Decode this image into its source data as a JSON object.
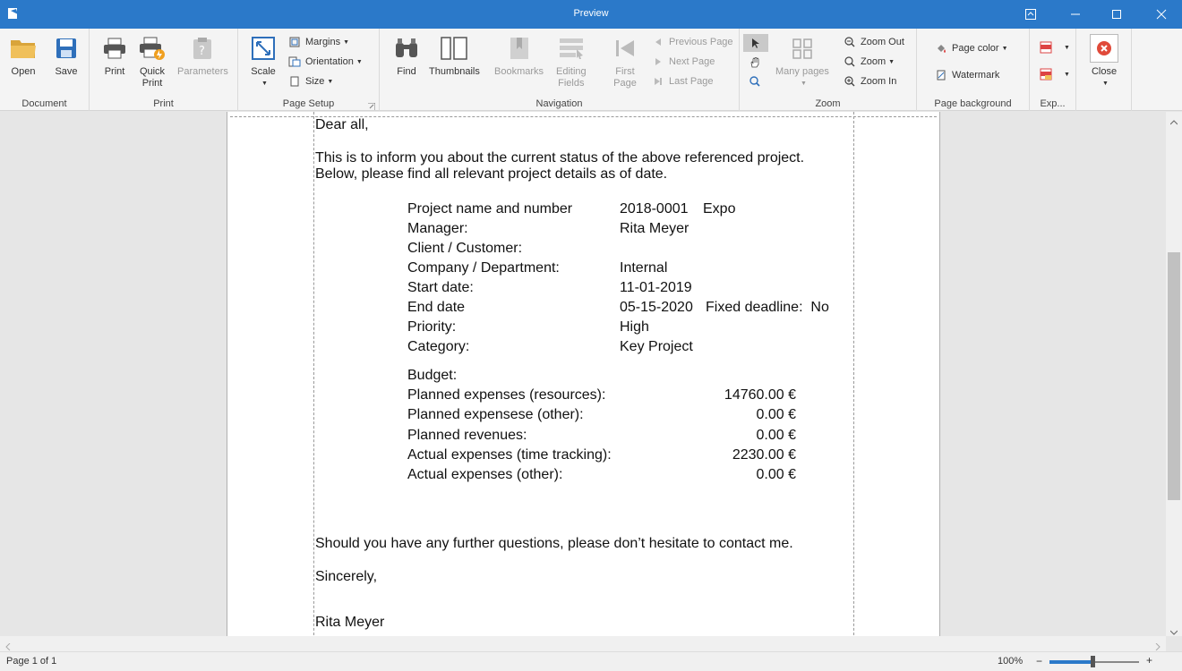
{
  "window": {
    "title": "Preview"
  },
  "ribbon": {
    "groups": {
      "document": "Document",
      "print": "Print",
      "page_setup": "Page Setup",
      "navigation": "Navigation",
      "zoom": "Zoom",
      "page_background": "Page background",
      "export": "Exp..."
    },
    "buttons": {
      "open": "Open",
      "save": "Save",
      "print": "Print",
      "quick_print_1": "Quick",
      "quick_print_2": "Print",
      "parameters": "Parameters",
      "scale": "Scale",
      "margins": "Margins",
      "orientation": "Orientation",
      "size": "Size",
      "find": "Find",
      "thumbnails": "Thumbnails",
      "bookmarks": "Bookmarks",
      "editing_fields_1": "Editing",
      "editing_fields_2": "Fields",
      "first_page_1": "First",
      "first_page_2": "Page",
      "previous_page": "Previous Page",
      "next_page": "Next Page",
      "last_page": "Last Page",
      "many_pages": "Many pages",
      "zoom_out": "Zoom Out",
      "zoom": "Zoom",
      "zoom_in": "Zoom In",
      "page_color": "Page color",
      "watermark": "Watermark",
      "close": "Close"
    }
  },
  "document": {
    "greeting": "Dear all,",
    "intro_1": "This is to inform you about the current status of the above referenced project.",
    "intro_2": "Below, please find all relevant project details as of date.",
    "details": [
      {
        "label": "Project name and number",
        "value": "2018-0001",
        "extra": "Expo"
      },
      {
        "label": "Manager:",
        "value": "Rita Meyer"
      },
      {
        "label": "Client / Customer:",
        "value": ""
      },
      {
        "label": "Company / Department:",
        "value": "Internal"
      },
      {
        "label": "Start date:",
        "value": "11-01-2019"
      },
      {
        "label": "End date",
        "value": "05-15-2020",
        "extra": "Fixed deadline:  No"
      },
      {
        "label": "Priority:",
        "value": "High"
      },
      {
        "label": "Category:",
        "value": "Key Project"
      }
    ],
    "budget_label": "Budget:",
    "budget": [
      {
        "label": "Planned expenses (resources):",
        "amount": "14760.00 €"
      },
      {
        "label": "Planned expensese (other):",
        "amount": "0.00 €"
      },
      {
        "label": "Planned revenues:",
        "amount": "0.00 €"
      },
      {
        "label": "Actual expenses (time tracking):",
        "amount": "2230.00 €"
      },
      {
        "label": "Actual expenses (other):",
        "amount": "0.00 €"
      }
    ],
    "closing": "Should you have any further questions, please don’t hesitate to contact me.",
    "sign_off": "Sincerely,",
    "signature": "Rita Meyer"
  },
  "status": {
    "page_info": "Page 1 of 1",
    "zoom_level": "100%",
    "zoom_fraction": 0.5
  },
  "colors": {
    "accent": "#2b79c9",
    "close_red": "#e04a3a"
  }
}
